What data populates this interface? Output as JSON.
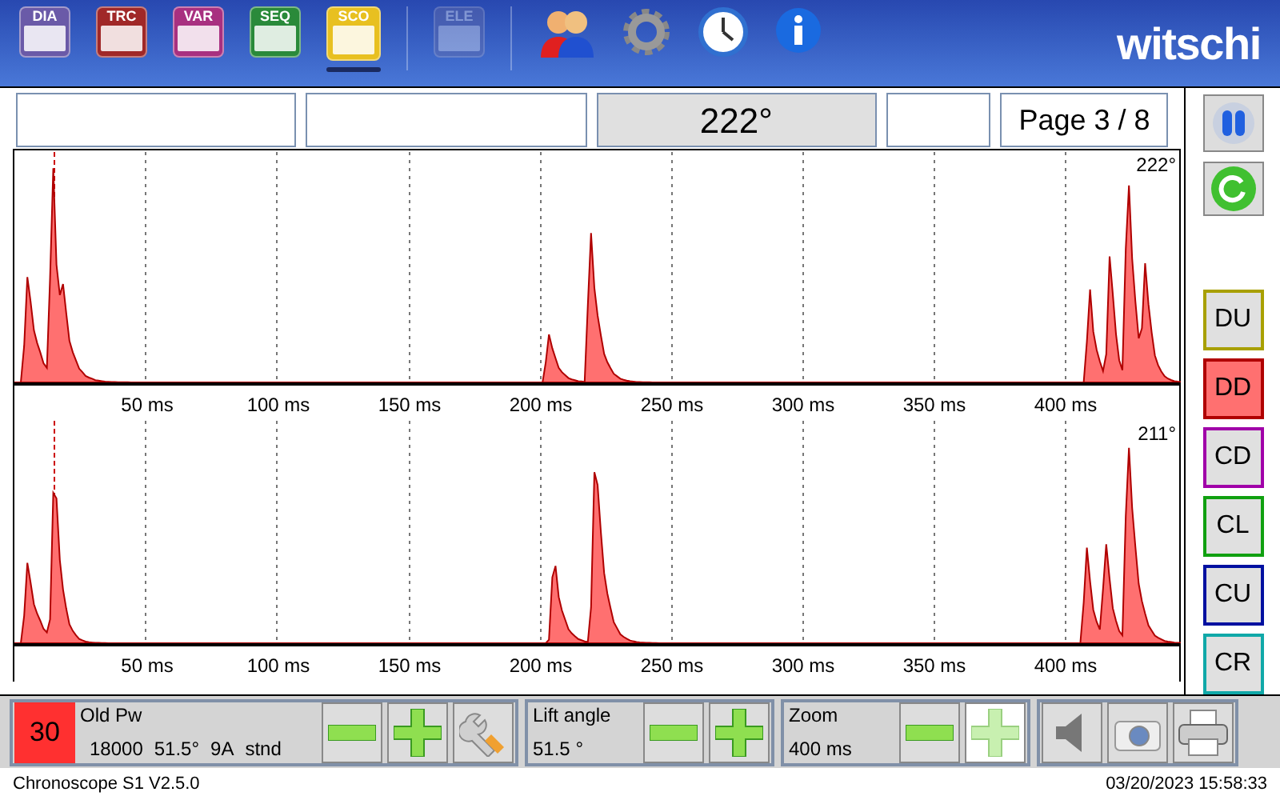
{
  "toolbar": {
    "apps": [
      {
        "label": "DIA",
        "kind": "dia",
        "selected": false,
        "disabled": false
      },
      {
        "label": "TRC",
        "kind": "trc",
        "selected": false,
        "disabled": false
      },
      {
        "label": "VAR",
        "kind": "var",
        "selected": false,
        "disabled": false
      },
      {
        "label": "SEQ",
        "kind": "seq",
        "selected": false,
        "disabled": false
      },
      {
        "label": "SCO",
        "kind": "sco",
        "selected": true,
        "disabled": false
      },
      {
        "label": "ELE",
        "kind": "ele",
        "selected": false,
        "disabled": true
      }
    ],
    "logo": "witschi"
  },
  "header_fields": [
    {
      "kind": "blank"
    },
    {
      "kind": "blank"
    },
    {
      "value": "222°",
      "kind": "angle"
    },
    {
      "kind": "blank"
    },
    {
      "value": "Page 3 / 8",
      "kind": "page"
    }
  ],
  "plots": [
    {
      "angle": "222°",
      "x_labels": [
        "50 ms",
        "100 ms",
        "150 ms",
        "200 ms",
        "250 ms",
        "300 ms",
        "350 ms",
        "400 ms"
      ]
    },
    {
      "angle": "211°",
      "x_labels": [
        "50 ms",
        "100 ms",
        "150 ms",
        "200 ms",
        "250 ms",
        "300 ms",
        "350 ms",
        "400 ms"
      ]
    }
  ],
  "modes": [
    {
      "label": "DU",
      "color": "#a8a000",
      "selected": false
    },
    {
      "label": "DD",
      "color": "#b00000",
      "selected": true
    },
    {
      "label": "CD",
      "color": "#a000a8",
      "selected": false
    },
    {
      "label": "CL",
      "color": "#10a010",
      "selected": false
    },
    {
      "label": "CU",
      "color": "#0010a0",
      "selected": false
    },
    {
      "label": "CR",
      "color": "#10a8a8",
      "selected": false
    }
  ],
  "bottom": {
    "count": "30",
    "title": "Old Pw",
    "params": [
      "18000",
      "51.5°",
      "9A",
      "stnd"
    ],
    "lift": {
      "label": "Lift angle",
      "value": "51.5 °"
    },
    "zoom": {
      "label": "Zoom",
      "value": "400 ms",
      "plus_disabled": true
    }
  },
  "status_bar": {
    "version": "Chronoscope S1 V2.5.0",
    "datetime": "03/20/2023 15:58:33"
  }
}
